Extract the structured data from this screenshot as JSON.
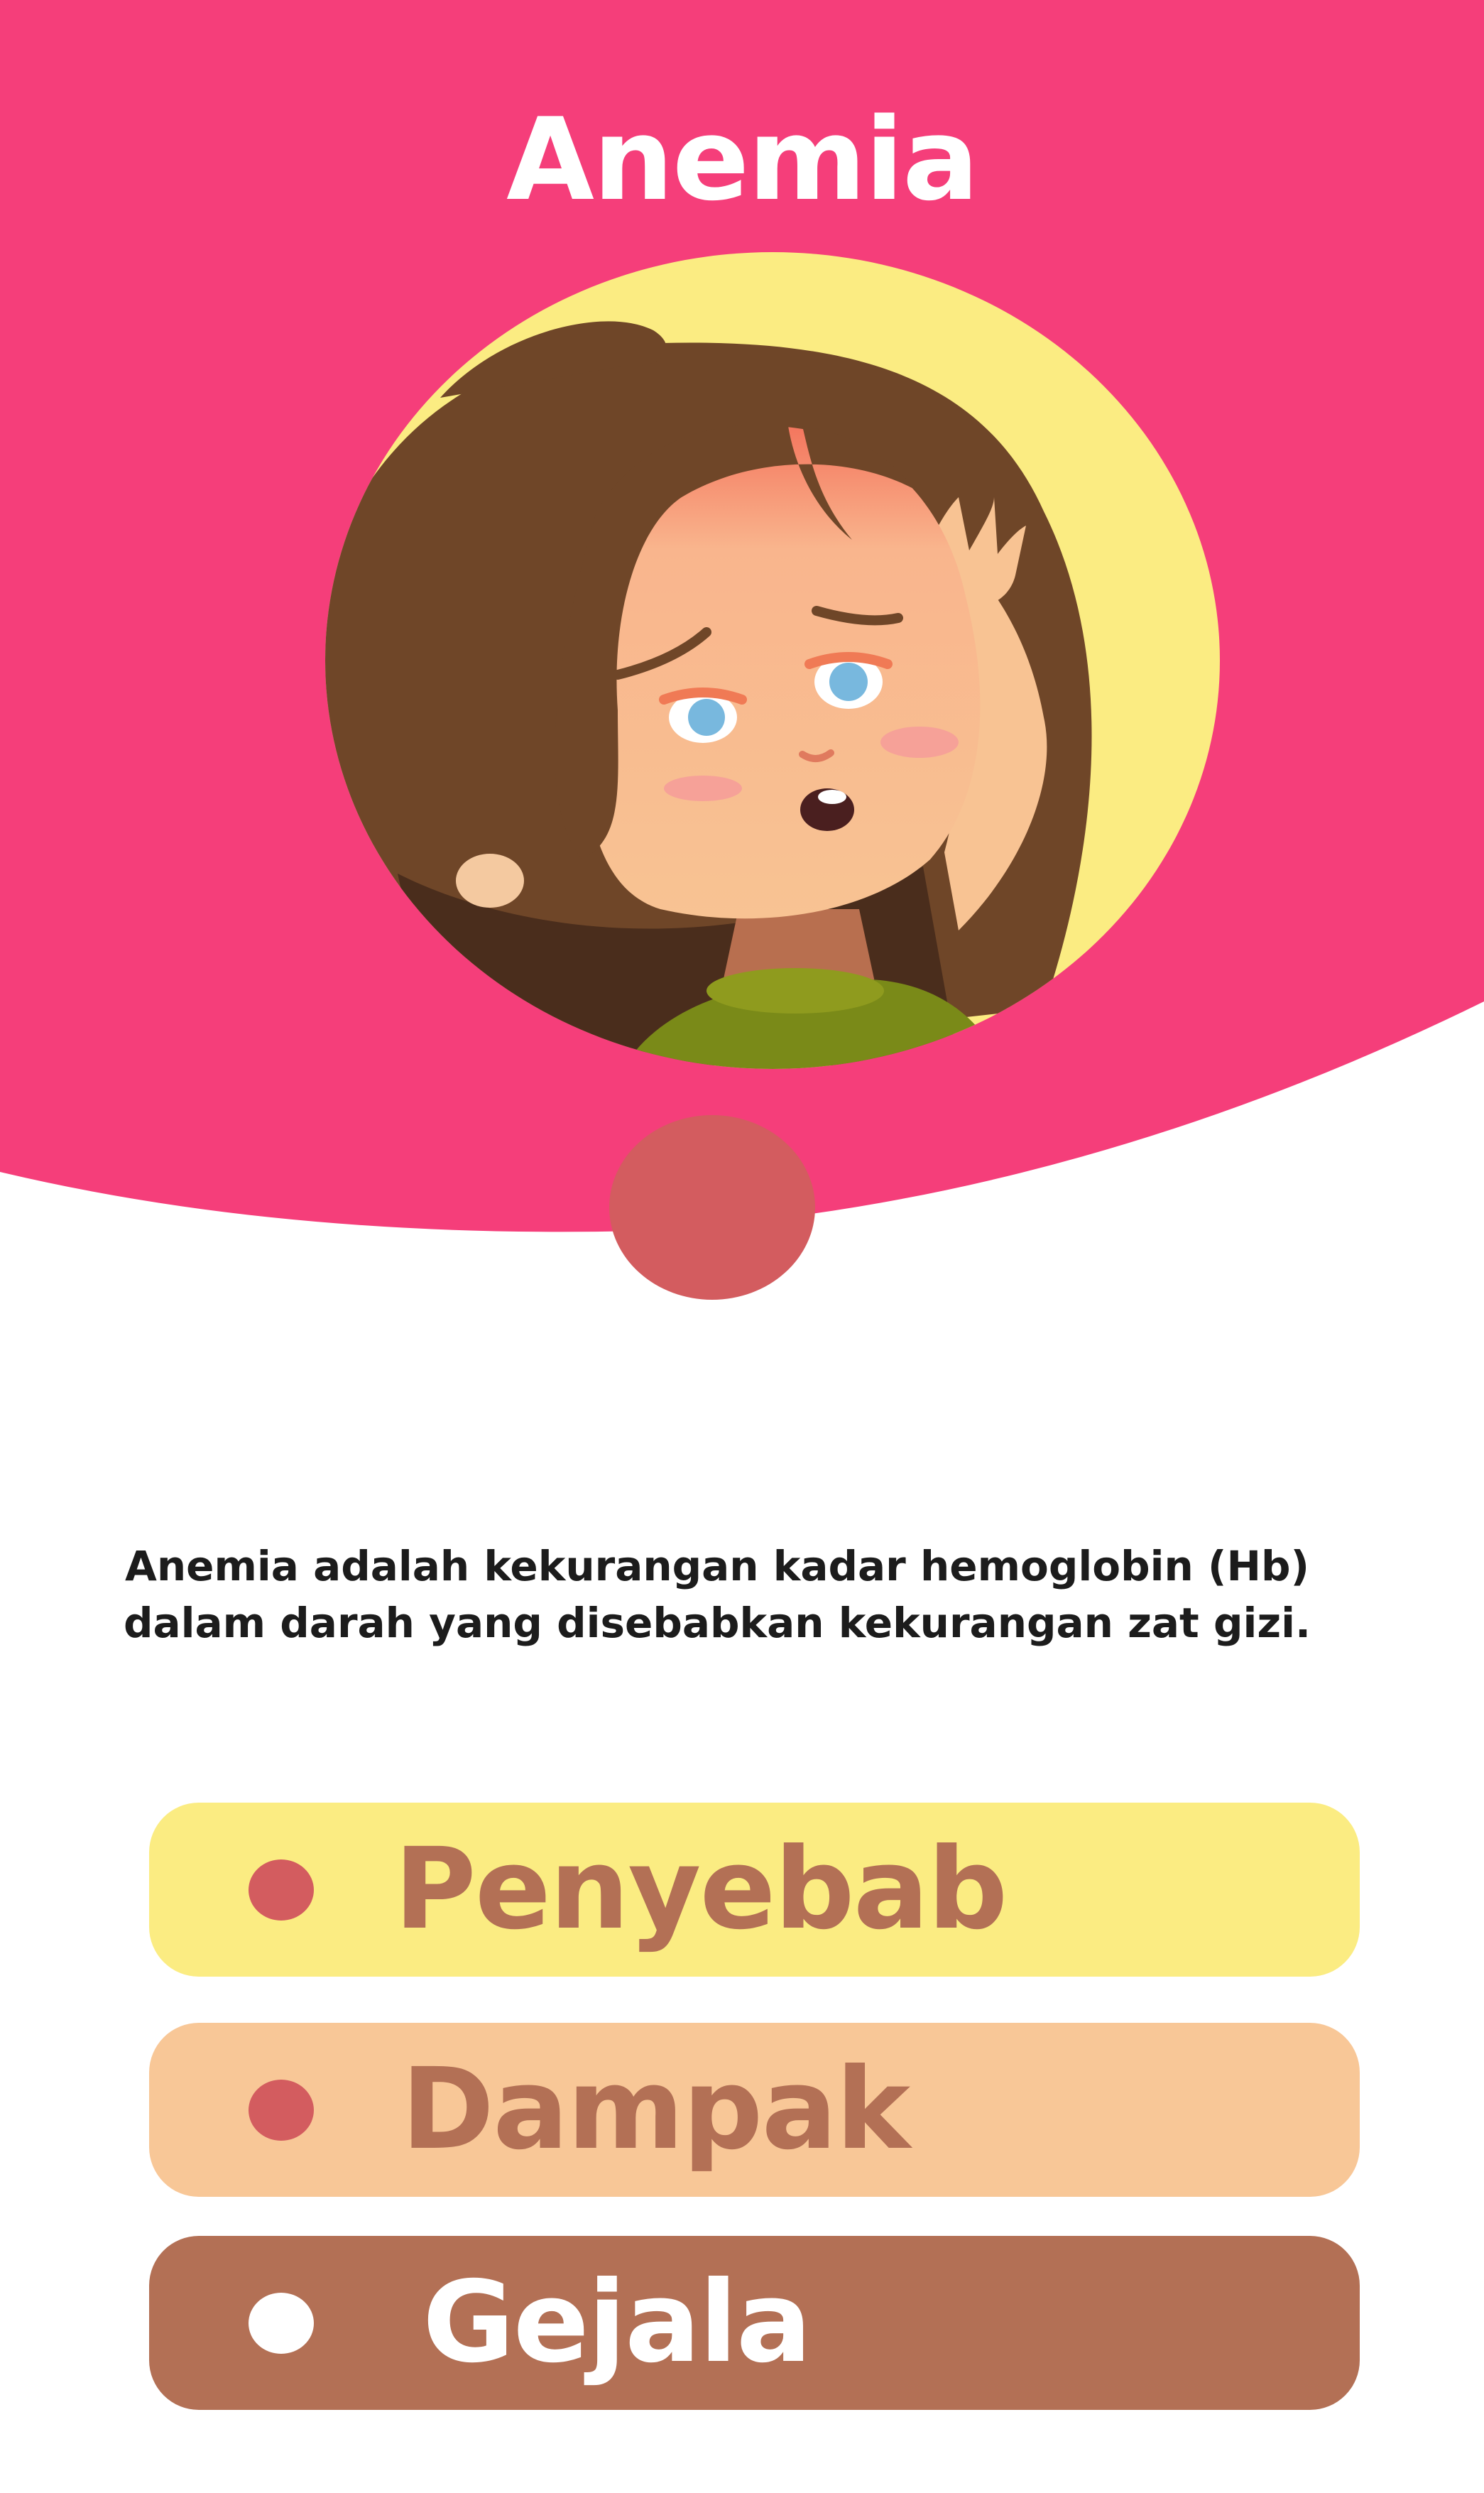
{
  "header": {
    "title": "Anemia"
  },
  "illustration": {
    "subject": "girl with headache",
    "icon": "tired-girl-illustration"
  },
  "description": {
    "text": "Anemia adalah kekurangan kadar hemoglobin (Hb) dalam darah yang disebabkan kekurangan zat gizi."
  },
  "menu": {
    "items": [
      {
        "label": "Penyebab"
      },
      {
        "label": "Dampak"
      },
      {
        "label": "Gejala"
      }
    ]
  },
  "colors": {
    "header_pink": "#f53e7a",
    "circle_yellow": "#fbec82",
    "accent_red": "#d35c5f",
    "penyebab_bg": "#fbec82",
    "dampak_bg": "#f8c797",
    "gejala_bg": "#b37055",
    "brown_text": "#b37055"
  }
}
